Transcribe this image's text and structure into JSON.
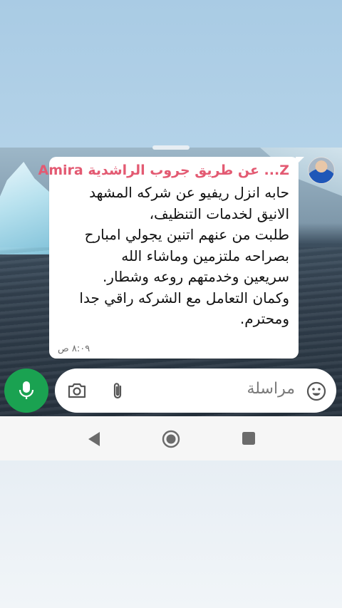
{
  "chat": {
    "sender": "Z... عن طريق جروب الراشدية Amira",
    "message": "حابه انزل ريفيو عن شركه المشهد\nالانيق لخدمات التنظيف،\nطلبت من عنهم اتنين يجولي امبارح\nبصراحه ملتزمين وماشاء الله\nسريعين وخدمتهم روعه وشطار.\nوكمان التعامل مع الشركه راقي جدا\nومحترم.",
    "time": "٨:٠٩ ص",
    "sender_color": "#e35a72"
  },
  "composer": {
    "placeholder": "مراسلة",
    "icons": [
      "emoji-icon",
      "attach-icon",
      "camera-icon",
      "mic-icon"
    ],
    "mic_color": "#1aa251"
  },
  "navigation": {
    "icons": [
      "back-icon",
      "home-icon",
      "recents-icon"
    ]
  }
}
